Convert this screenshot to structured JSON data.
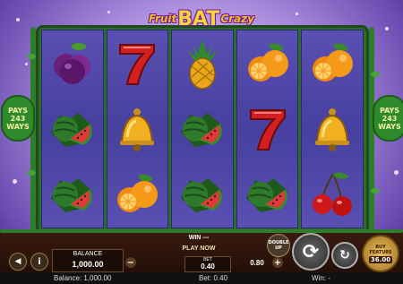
{
  "game": {
    "logo": {
      "fruit": "Fruit",
      "bat": "BAT",
      "crazy": "Crazy"
    },
    "pays_left": [
      "PAYS",
      "243",
      "WAYS"
    ],
    "pays_right": [
      "PAYS",
      "243",
      "WAYS"
    ]
  },
  "reels": [
    [
      "plum",
      "watermelon",
      "watermelon"
    ],
    [
      "seven",
      "bell",
      "orange"
    ],
    [
      "pineapple",
      "watermelon",
      "watermelon"
    ],
    [
      "orange",
      "seven",
      "watermelon"
    ],
    [
      "orange",
      "bell",
      "cherry"
    ]
  ],
  "panel": {
    "balance_label": "BALANCE",
    "balance_value": "1,000.00",
    "win_label": "WIN",
    "win_value": "---",
    "play_now": "PLAY NOW",
    "bet_label": "BET",
    "bet_value": "0.40",
    "bet_alt": "0.80",
    "double_up": "DOUBLE UP",
    "buy_feature_label": "BUY FEATURE",
    "buy_feature_value": "36.00",
    "minus": "−",
    "plus": "+",
    "info": "i"
  },
  "status": {
    "balance": "Balance: 1,000.00",
    "bet": "Bet: 0.40",
    "win": "Win: -"
  },
  "colors": {
    "reel_bg": "#5046a8",
    "vine": "#2f7d2b",
    "panel": "#2a130a",
    "logo": "#f6d53a"
  }
}
